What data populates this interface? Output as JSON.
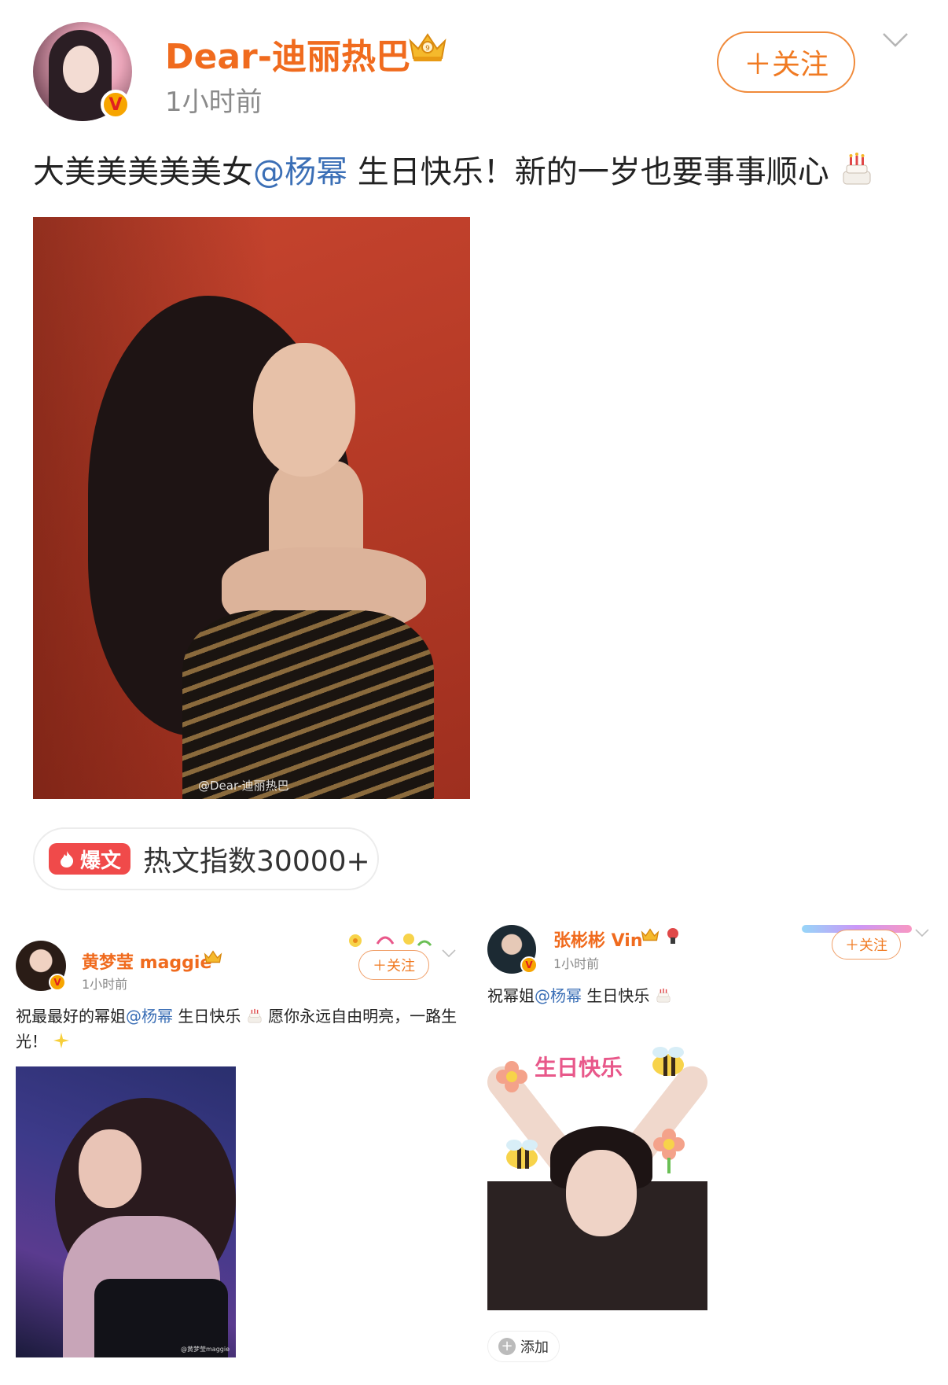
{
  "main_post": {
    "username": "Dear-迪丽热巴",
    "time": "1小时前",
    "follow_label": "＋关注",
    "text_before": "大美美美美美女",
    "mention": "@杨幂",
    "text_after": " 生日快乐！新的一岁也要事事顺心",
    "image_watermark": "@Dear-迪丽热巴",
    "hot_tag": "爆文",
    "hot_text": "热文指数30000+"
  },
  "repost_left": {
    "username": "黄梦莹 maggie",
    "time": "1小时前",
    "follow_label": "＋关注",
    "text_before": "祝最最好的幂姐",
    "mention": "@杨幂",
    "text_mid": " 生日快乐",
    "text_after": "愿你永远自由明亮，一路生光！",
    "image_watermark": "@黄梦莹maggie"
  },
  "repost_right": {
    "username": "张彬彬 Vin",
    "time": "1小时前",
    "follow_label": "＋关注",
    "text_before": "祝幂姐",
    "mention": "@杨幂",
    "text_after": " 生日快乐",
    "image_sticker_text": "生日快乐",
    "add_label": "添加"
  },
  "colors": {
    "username": "#f06b1e",
    "mention": "#3b6fb6",
    "follow_border": "#f08a3a",
    "hot_tag_bg": "#f04a4a",
    "verified_badge": "#f7a500"
  },
  "icons": [
    "crown-icon",
    "verified-icon",
    "chevron-down-icon",
    "cake-icon",
    "weibo-fire-icon",
    "sparkle-icon",
    "plus-icon"
  ]
}
